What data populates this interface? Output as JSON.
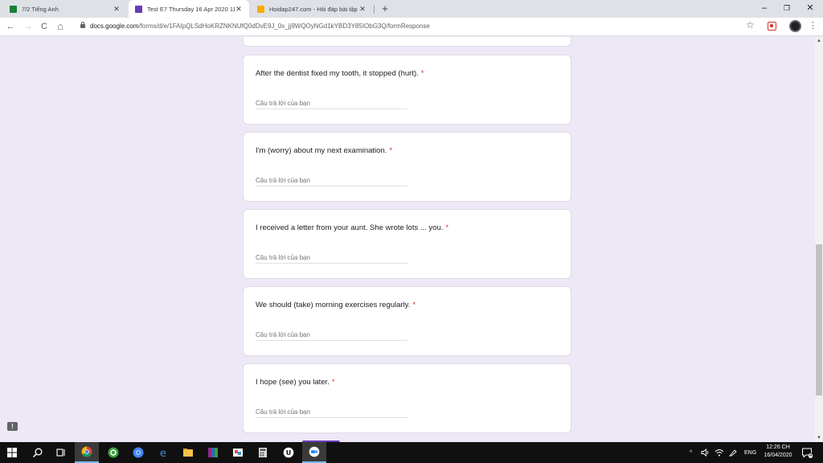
{
  "browser": {
    "tabs": [
      {
        "title": "7/2 Tiếng Anh",
        "active": false,
        "favicon_color": "#188038"
      },
      {
        "title": "Test E7 Thursday 16 Apr 2020 11:",
        "active": true,
        "favicon_color": "#673ab7"
      },
      {
        "title": "Hoidap247.com - Hỏi đáp bài tập",
        "active": false,
        "favicon_color": "#f9ab00"
      }
    ],
    "new_tab_glyph": "+",
    "window_controls": {
      "minimize": "–",
      "maximize": "❐",
      "close": "✕"
    },
    "nav": {
      "back": "←",
      "forward": "→",
      "reload": "C",
      "home": "⌂"
    },
    "url_host": "docs.google.com",
    "url_path": "/forms/d/e/1FAIpQLSdHoKRZNKNUfQ0dDvE9J_0x_jj9WQOyNGd1kYBD3Y85IObG3Q/formResponse",
    "star_glyph": "☆",
    "menu_glyph": "⋮"
  },
  "form": {
    "questions": [
      {
        "text": "After the dentist fixed my tooth, it stopped (hurt).",
        "required_mark": "*",
        "placeholder": "Câu trả lời của bạn"
      },
      {
        "text": "I'm (worry) about my next examination.",
        "required_mark": "*",
        "placeholder": "Câu trả lời của bạn"
      },
      {
        "text": "I received a letter from your aunt. She wrote lots ... you.",
        "required_mark": "*",
        "placeholder": "Câu trả lời của bạn"
      },
      {
        "text": "We should (take) morning exercises regularly.",
        "required_mark": "*",
        "placeholder": "Câu trả lời của bạn"
      },
      {
        "text": "I hope (see) you later.",
        "required_mark": "*",
        "placeholder": "Câu trả lời của bạn"
      }
    ],
    "feedback_glyph": "!"
  },
  "taskbar": {
    "apps": [
      "start-icon",
      "search-icon",
      "task-view-icon",
      "chrome-icon",
      "green-app-icon",
      "chrome-alt-icon",
      "edge-icon",
      "file-explorer-icon",
      "winrar-icon",
      "paint-icon",
      "calculator-icon",
      "unreal-icon",
      "zoom-icon"
    ],
    "tray_chevron": "^",
    "language": "ENG",
    "time": "12:26 CH",
    "date": "16/04/2020",
    "notifications_count": "4"
  },
  "colors": {
    "accent": "#673ab7",
    "required": "#d93025",
    "page_bg": "#ede7f6"
  }
}
